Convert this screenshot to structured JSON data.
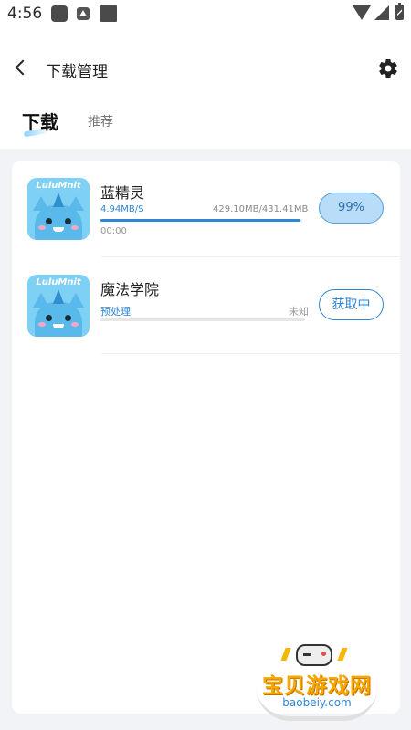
{
  "status_bar": {
    "time": "4:56",
    "icons": [
      "app-notification-icon",
      "android-icon",
      "square-icon",
      "wifi-icon",
      "signal-icon",
      "battery-icon"
    ]
  },
  "app_bar": {
    "title": "下载管理",
    "back_icon": "back-arrow-icon",
    "settings_icon": "gear-icon"
  },
  "tabs": [
    {
      "label": "下载",
      "active": true
    },
    {
      "label": "推荐",
      "active": false
    }
  ],
  "downloads": [
    {
      "name": "蓝精灵",
      "icon_brand": "LuluMnit",
      "speed": "4.94MB/S",
      "size": "429.10MB/431.41MB",
      "elapsed": "00:00",
      "progress": 0.99,
      "action_label": "99%"
    },
    {
      "name": "魔法学院",
      "icon_brand": "LuluMnit",
      "status": "预处理",
      "size": "未知",
      "progress": 0,
      "action_label": "获取中"
    }
  ],
  "watermark": {
    "text": "宝贝游戏网",
    "url": "baobeiy.com"
  },
  "colors": {
    "accent": "#2f86d6",
    "content_bg": "#f2f3f7",
    "watermark": "#f6a800"
  }
}
